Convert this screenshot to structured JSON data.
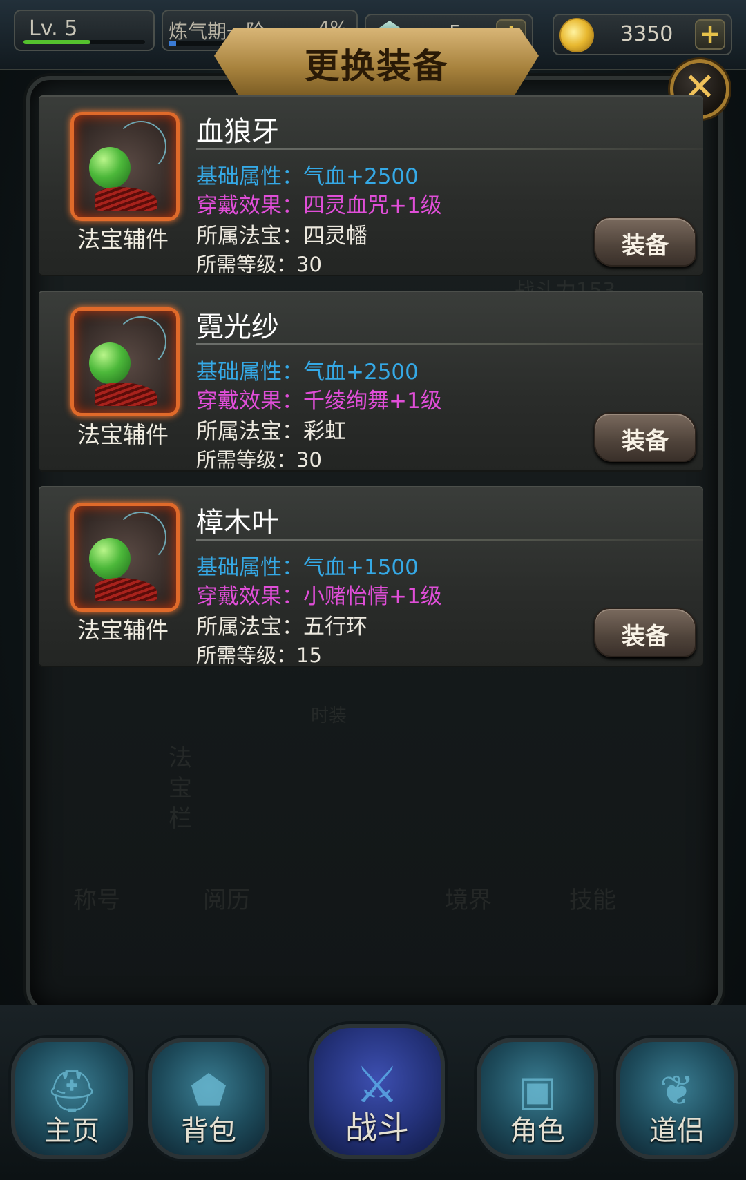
{
  "top_bar": {
    "level_label": "Lv. 5",
    "level_progress": 0.55,
    "realm_name": "炼气期一阶",
    "realm_percent": "4%",
    "realm_progress": 0.04,
    "gem_count": "5",
    "gold_count": "3350"
  },
  "dialog": {
    "title": "更换装备",
    "close_icon": "close-icon"
  },
  "items": [
    {
      "name": "血狼牙",
      "category": "法宝辅件",
      "base_attr": "基础属性：气血+2500",
      "effect": "穿戴效果：四灵血咒+1级",
      "owner": "所属法宝：四灵幡",
      "level": "所需等级：30",
      "button": "装备"
    },
    {
      "name": "霓光纱",
      "category": "法宝辅件",
      "base_attr": "基础属性：气血+2500",
      "effect": "穿戴效果：千绫绚舞+1级",
      "owner": "所属法宝：彩虹",
      "level": "所需等级：30",
      "button": "装备"
    },
    {
      "name": "樟木叶",
      "category": "法宝辅件",
      "base_attr": "基础属性：气血+1500",
      "effect": "穿戴效果：小赌怡情+1级",
      "owner": "所属法宝：五行环",
      "level": "所需等级：15",
      "button": "装备"
    }
  ],
  "background_text": {
    "tabs": [
      "称号",
      "阅历",
      "境界",
      "技能"
    ],
    "slot_label": "法宝栏",
    "costume": "时装",
    "power": "战斗力153"
  },
  "bottom_nav": [
    {
      "label": "主页",
      "icon": "helmet-icon"
    },
    {
      "label": "背包",
      "icon": "bag-icon"
    },
    {
      "label": "战斗",
      "icon": "swords-icon"
    },
    {
      "label": "角色",
      "icon": "chest-icon"
    },
    {
      "label": "道侣",
      "icon": "partner-icon"
    }
  ],
  "colors": {
    "base_attr": "#35a9e6",
    "effect": "#e04ed8",
    "frame_glow": "#e06a2a",
    "title_gold": "#d9b677"
  }
}
